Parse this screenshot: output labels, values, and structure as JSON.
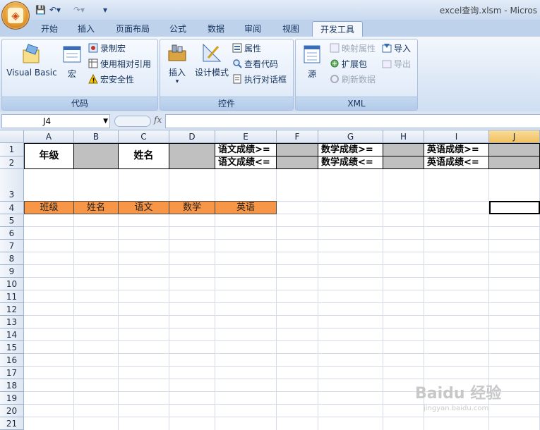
{
  "window": {
    "title": "excel查询.xlsm - Micros"
  },
  "tabs": [
    "开始",
    "插入",
    "页面布局",
    "公式",
    "数据",
    "审阅",
    "视图",
    "开发工具"
  ],
  "active_tab": "开发工具",
  "ribbon": {
    "code": {
      "label": "代码",
      "visual_basic": "Visual Basic",
      "macros": "宏",
      "record_macro": "录制宏",
      "relative_ref": "使用相对引用",
      "macro_security": "宏安全性"
    },
    "controls": {
      "label": "控件",
      "insert": "插入",
      "design_mode": "设计模式",
      "properties": "属性",
      "view_code": "查看代码",
      "run_dialog": "执行对话框"
    },
    "xml": {
      "label": "XML",
      "source": "源",
      "map_properties": "映射属性",
      "expansion_packs": "扩展包",
      "refresh_data": "刷新数据",
      "import": "导入",
      "export": "导出"
    }
  },
  "formula_bar": {
    "name_box": "J4",
    "fx": "fx",
    "formula": ""
  },
  "columns": [
    "A",
    "B",
    "C",
    "D",
    "E",
    "F",
    "G",
    "H",
    "I",
    "J"
  ],
  "selected_column": "J",
  "rows": [
    "1",
    "2",
    "3",
    "4",
    "5",
    "6",
    "7",
    "8",
    "9",
    "10",
    "11",
    "12",
    "13",
    "14",
    "15",
    "16",
    "17",
    "18",
    "19",
    "20",
    "21"
  ],
  "cells": {
    "A1": "年级",
    "C1": "姓名",
    "E1": "语文成绩>=",
    "E2": "语文成绩<=",
    "G1": "数学成绩>=",
    "G2": "数学成绩<=",
    "I1": "英语成绩>=",
    "I2": "英语成绩<=",
    "header_row": [
      "班级",
      "姓名",
      "语文",
      "数学",
      "英语"
    ]
  },
  "watermark": {
    "brand": "Baidu 经验",
    "url": "jingyan.baidu.com"
  }
}
